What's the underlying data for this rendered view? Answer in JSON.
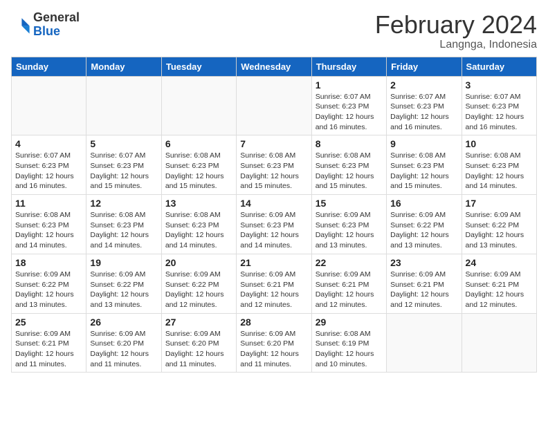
{
  "header": {
    "logo": {
      "general": "General",
      "blue": "Blue"
    },
    "month": "February 2024",
    "location": "Langnga, Indonesia"
  },
  "days_of_week": [
    "Sunday",
    "Monday",
    "Tuesday",
    "Wednesday",
    "Thursday",
    "Friday",
    "Saturday"
  ],
  "weeks": [
    [
      {
        "day": "",
        "info": ""
      },
      {
        "day": "",
        "info": ""
      },
      {
        "day": "",
        "info": ""
      },
      {
        "day": "",
        "info": ""
      },
      {
        "day": "1",
        "info": "Sunrise: 6:07 AM\nSunset: 6:23 PM\nDaylight: 12 hours and 16 minutes."
      },
      {
        "day": "2",
        "info": "Sunrise: 6:07 AM\nSunset: 6:23 PM\nDaylight: 12 hours and 16 minutes."
      },
      {
        "day": "3",
        "info": "Sunrise: 6:07 AM\nSunset: 6:23 PM\nDaylight: 12 hours and 16 minutes."
      }
    ],
    [
      {
        "day": "4",
        "info": "Sunrise: 6:07 AM\nSunset: 6:23 PM\nDaylight: 12 hours and 16 minutes."
      },
      {
        "day": "5",
        "info": "Sunrise: 6:07 AM\nSunset: 6:23 PM\nDaylight: 12 hours and 15 minutes."
      },
      {
        "day": "6",
        "info": "Sunrise: 6:08 AM\nSunset: 6:23 PM\nDaylight: 12 hours and 15 minutes."
      },
      {
        "day": "7",
        "info": "Sunrise: 6:08 AM\nSunset: 6:23 PM\nDaylight: 12 hours and 15 minutes."
      },
      {
        "day": "8",
        "info": "Sunrise: 6:08 AM\nSunset: 6:23 PM\nDaylight: 12 hours and 15 minutes."
      },
      {
        "day": "9",
        "info": "Sunrise: 6:08 AM\nSunset: 6:23 PM\nDaylight: 12 hours and 15 minutes."
      },
      {
        "day": "10",
        "info": "Sunrise: 6:08 AM\nSunset: 6:23 PM\nDaylight: 12 hours and 14 minutes."
      }
    ],
    [
      {
        "day": "11",
        "info": "Sunrise: 6:08 AM\nSunset: 6:23 PM\nDaylight: 12 hours and 14 minutes."
      },
      {
        "day": "12",
        "info": "Sunrise: 6:08 AM\nSunset: 6:23 PM\nDaylight: 12 hours and 14 minutes."
      },
      {
        "day": "13",
        "info": "Sunrise: 6:08 AM\nSunset: 6:23 PM\nDaylight: 12 hours and 14 minutes."
      },
      {
        "day": "14",
        "info": "Sunrise: 6:09 AM\nSunset: 6:23 PM\nDaylight: 12 hours and 14 minutes."
      },
      {
        "day": "15",
        "info": "Sunrise: 6:09 AM\nSunset: 6:23 PM\nDaylight: 12 hours and 13 minutes."
      },
      {
        "day": "16",
        "info": "Sunrise: 6:09 AM\nSunset: 6:22 PM\nDaylight: 12 hours and 13 minutes."
      },
      {
        "day": "17",
        "info": "Sunrise: 6:09 AM\nSunset: 6:22 PM\nDaylight: 12 hours and 13 minutes."
      }
    ],
    [
      {
        "day": "18",
        "info": "Sunrise: 6:09 AM\nSunset: 6:22 PM\nDaylight: 12 hours and 13 minutes."
      },
      {
        "day": "19",
        "info": "Sunrise: 6:09 AM\nSunset: 6:22 PM\nDaylight: 12 hours and 13 minutes."
      },
      {
        "day": "20",
        "info": "Sunrise: 6:09 AM\nSunset: 6:22 PM\nDaylight: 12 hours and 12 minutes."
      },
      {
        "day": "21",
        "info": "Sunrise: 6:09 AM\nSunset: 6:21 PM\nDaylight: 12 hours and 12 minutes."
      },
      {
        "day": "22",
        "info": "Sunrise: 6:09 AM\nSunset: 6:21 PM\nDaylight: 12 hours and 12 minutes."
      },
      {
        "day": "23",
        "info": "Sunrise: 6:09 AM\nSunset: 6:21 PM\nDaylight: 12 hours and 12 minutes."
      },
      {
        "day": "24",
        "info": "Sunrise: 6:09 AM\nSunset: 6:21 PM\nDaylight: 12 hours and 12 minutes."
      }
    ],
    [
      {
        "day": "25",
        "info": "Sunrise: 6:09 AM\nSunset: 6:21 PM\nDaylight: 12 hours and 11 minutes."
      },
      {
        "day": "26",
        "info": "Sunrise: 6:09 AM\nSunset: 6:20 PM\nDaylight: 12 hours and 11 minutes."
      },
      {
        "day": "27",
        "info": "Sunrise: 6:09 AM\nSunset: 6:20 PM\nDaylight: 12 hours and 11 minutes."
      },
      {
        "day": "28",
        "info": "Sunrise: 6:09 AM\nSunset: 6:20 PM\nDaylight: 12 hours and 11 minutes."
      },
      {
        "day": "29",
        "info": "Sunrise: 6:08 AM\nSunset: 6:19 PM\nDaylight: 12 hours and 10 minutes."
      },
      {
        "day": "",
        "info": ""
      },
      {
        "day": "",
        "info": ""
      }
    ]
  ]
}
